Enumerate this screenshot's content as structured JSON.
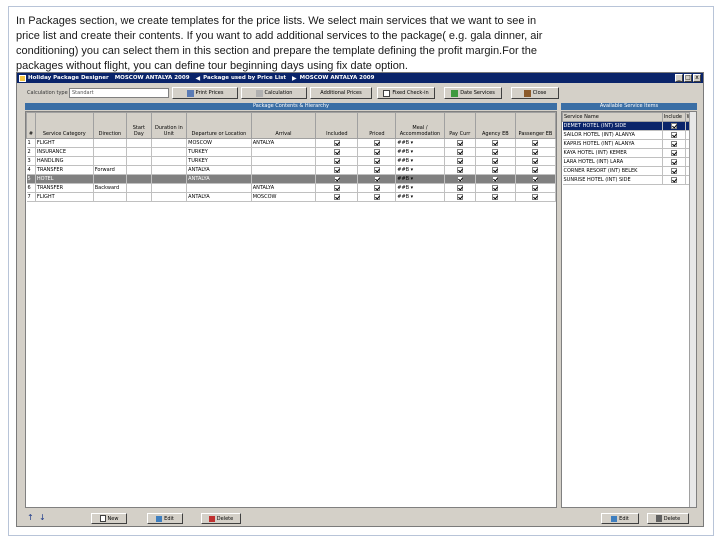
{
  "slide": {
    "text": "In Packages section, we create templates for the price lists. We select main services that we want to see in price list and create their contents. If you want to add additional services to the package( e.g. gala dinner, air conditioning) you can select them in this section and prepare the template defining the profit margin.For the packages without flight, you can define tour beginning days using fix date option."
  },
  "app": {
    "title": "Holiday Package Designer",
    "title_package": "MOSCOW ANTALYA 2009",
    "title_used_by": "Package used by Price List",
    "title_package2": "MOSCOW ANTALYA 2009",
    "win_min": "_",
    "win_max": "□",
    "win_close": "x"
  },
  "toolbar": {
    "label": "Calculation type",
    "field_value": "Standart",
    "print_prices": "Print Prices",
    "calculation": "Calculation",
    "additional_prices": "Additional Prices",
    "fixed_checkin": "Fixed Check-in",
    "date_services": "Date Services",
    "close": "Close"
  },
  "left_panel": {
    "title": "Package Contents & Hierarchy",
    "headers": [
      "#",
      "Service Category",
      "Direction",
      "Start Day",
      "Duration in Unit",
      "Departure or Location",
      "Arrival",
      "Included",
      "Priced",
      "Meal / Accommodation",
      "Pay Curr",
      "Agency EB",
      "Passenger EB"
    ],
    "rows": [
      {
        "no": "1",
        "category": "FLIGHT",
        "direction": "",
        "start": "",
        "duration": "",
        "departure": "MOSCOW",
        "arrival": "ANTALYA",
        "included": true,
        "priced": true,
        "meal": "##B",
        "paycurr": true,
        "agency": true,
        "passenger": true
      },
      {
        "no": "2",
        "category": "INSURANCE",
        "direction": "",
        "start": "",
        "duration": "",
        "departure": "TURKEY",
        "arrival": "",
        "included": true,
        "priced": true,
        "meal": "##B",
        "paycurr": true,
        "agency": true,
        "passenger": true
      },
      {
        "no": "3",
        "category": "HANDLING",
        "direction": "",
        "start": "",
        "duration": "",
        "departure": "TURKEY",
        "arrival": "",
        "included": true,
        "priced": true,
        "meal": "##B",
        "paycurr": true,
        "agency": true,
        "passenger": true
      },
      {
        "no": "4",
        "category": "TRANSFER",
        "direction": "Forward",
        "start": "",
        "duration": "",
        "departure": "ANTALYA",
        "arrival": "",
        "included": true,
        "priced": true,
        "meal": "##B",
        "paycurr": true,
        "agency": true,
        "passenger": true
      },
      {
        "no": "5",
        "category": "HOTEL",
        "direction": "",
        "start": "",
        "duration": "",
        "departure": "ANTALYA",
        "arrival": "",
        "included": true,
        "priced": true,
        "meal": "##B",
        "paycurr": true,
        "agency": true,
        "passenger": true,
        "selected": true
      },
      {
        "no": "6",
        "category": "TRANSFER",
        "direction": "Backward",
        "start": "",
        "duration": "",
        "departure": "",
        "arrival": "ANTALYA",
        "included": true,
        "priced": true,
        "meal": "##B",
        "paycurr": true,
        "agency": true,
        "passenger": true
      },
      {
        "no": "7",
        "category": "FLIGHT",
        "direction": "",
        "start": "",
        "duration": "",
        "departure": "ANTALYA",
        "arrival": "MOSCOW",
        "included": true,
        "priced": true,
        "meal": "##B",
        "paycurr": true,
        "agency": true,
        "passenger": true
      }
    ]
  },
  "right_panel": {
    "title": "Available Service Items",
    "headers": [
      "Service Name",
      "Include",
      "W"
    ],
    "rows": [
      {
        "name": "DEMET HOTEL (INT) SIDE",
        "checked": true,
        "selected": true
      },
      {
        "name": "SAILOR HOTEL (INT) ALANYA",
        "checked": true
      },
      {
        "name": "KAPRIS HOTEL (INT) ALANYA",
        "checked": true
      },
      {
        "name": "KAYA HOTEL (INT) KEMER",
        "checked": true
      },
      {
        "name": "LARA HOTEL (INT) LARA",
        "checked": true
      },
      {
        "name": "CORNER RESORT (INT) BELEK",
        "checked": true
      },
      {
        "name": "SUNRISE HOTEL (INT) SIDE",
        "checked": true
      }
    ]
  },
  "bottombar": {
    "up": "↑",
    "down": "↓",
    "new": "New",
    "edit": "Edit",
    "delete": "Delete",
    "right_edit": "Edit",
    "right_delete": "Delete"
  },
  "colors": {
    "titlebar": "#0a246a",
    "selection": "#0a246a",
    "window": "#d4d0c8"
  }
}
